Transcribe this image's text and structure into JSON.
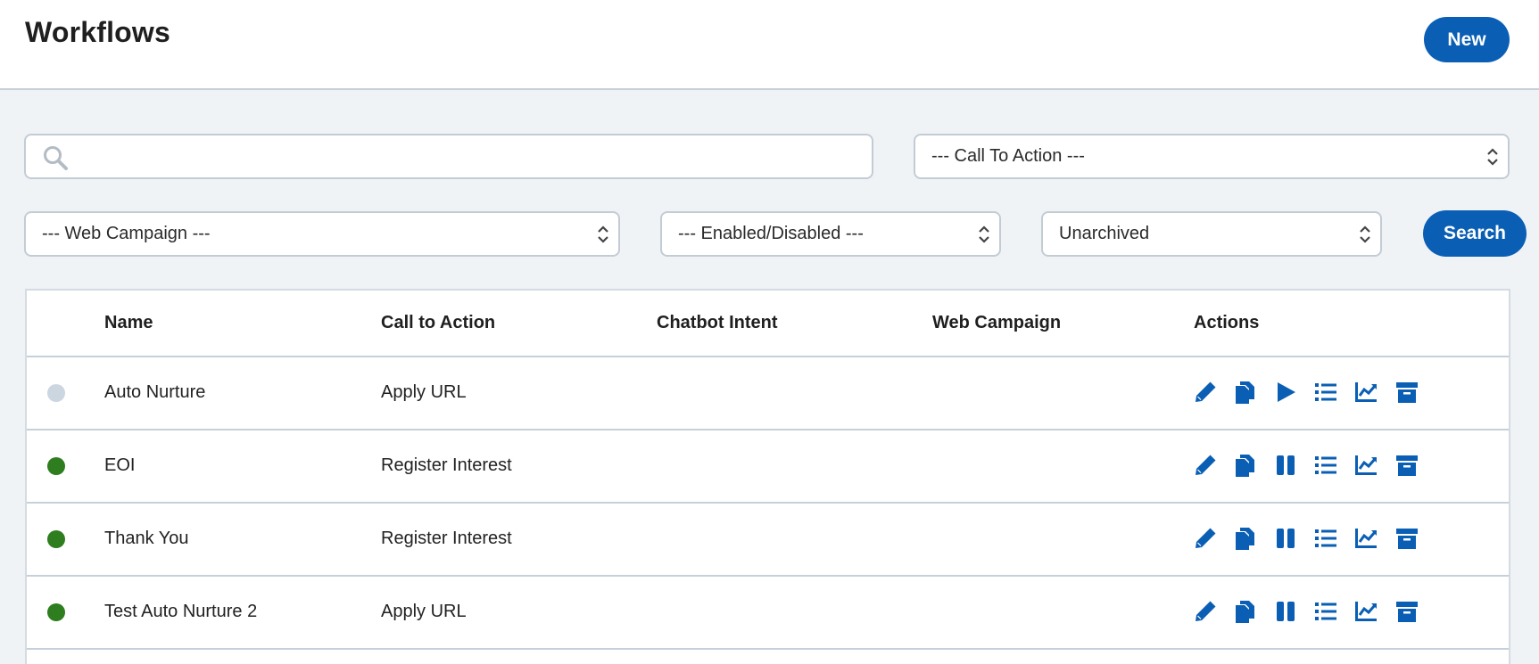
{
  "header": {
    "title": "Workflows",
    "new_label": "New"
  },
  "filters": {
    "search_placeholder": "",
    "call_to_action": "--- Call To Action ---",
    "web_campaign": "--- Web Campaign ---",
    "enabled_disabled": "--- Enabled/Disabled ---",
    "archive_status": "Unarchived",
    "search_label": "Search"
  },
  "table": {
    "columns": {
      "name": "Name",
      "call_to_action": "Call to Action",
      "chatbot_intent": "Chatbot Intent",
      "web_campaign": "Web Campaign",
      "actions": "Actions"
    },
    "rows": [
      {
        "status": "disabled",
        "name": "Auto Nurture",
        "call_to_action": "Apply URL",
        "chatbot_intent": "",
        "web_campaign": "",
        "toggle": "play"
      },
      {
        "status": "enabled",
        "name": "EOI",
        "call_to_action": "Register Interest",
        "chatbot_intent": "",
        "web_campaign": "",
        "toggle": "pause"
      },
      {
        "status": "enabled",
        "name": "Thank You",
        "call_to_action": "Register Interest",
        "chatbot_intent": "",
        "web_campaign": "",
        "toggle": "pause"
      },
      {
        "status": "enabled",
        "name": "Test Auto Nurture 2",
        "call_to_action": "Apply URL",
        "chatbot_intent": "",
        "web_campaign": "",
        "toggle": "pause"
      }
    ]
  },
  "colors": {
    "accent": "#0a5fb4",
    "enabled": "#2e7d1f",
    "disabled": "#ccd6e0"
  }
}
